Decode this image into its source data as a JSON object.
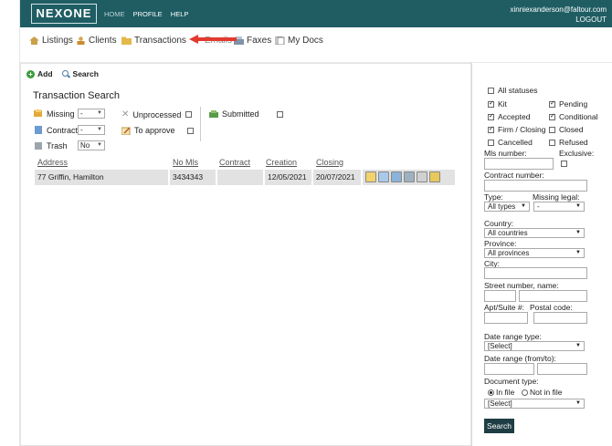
{
  "header": {
    "logo": "NEXONE",
    "nav": [
      "HOME",
      "PROFILE",
      "HELP"
    ],
    "user_email": "xinniexanderson@faltour.com",
    "logout": "LOGOUT"
  },
  "subnav": {
    "listings": "Listings",
    "clients": "Clients",
    "transactions": "Transactions",
    "emails_partial": "Emails",
    "faxes": "Faxes",
    "mydocs": "My Docs"
  },
  "toolbar": {
    "add": "Add",
    "search": "Search"
  },
  "search": {
    "title": "Transaction Search",
    "missing_label": "Missing",
    "missing_value": "-",
    "contract_label": "Contract",
    "contract_value": "-",
    "trash_label": "Trash",
    "trash_value": "No",
    "unprocessed_label": "Unprocessed",
    "to_approve_label": "To approve",
    "submitted_label": "Submitted"
  },
  "table": {
    "headers": [
      "Address",
      "No Mls",
      "Contract",
      "Creation",
      "Closing"
    ],
    "rows": [
      {
        "address": "77 Griffin, Hamilton",
        "no_mls": "3434343",
        "contract": "",
        "creation": "12/05/2021",
        "closing": "20/07/2021"
      }
    ]
  },
  "filters": {
    "all_statuses": "All statuses",
    "kit": "Kit",
    "pending": "Pending",
    "accepted": "Accepted",
    "conditional": "Conditional",
    "firm_closing": "Firm / Closing",
    "closed": "Closed",
    "cancelled": "Cancelled",
    "refused": "Refused",
    "mls_number": "Mls number:",
    "exclusive": "Exclusive:",
    "contract_number": "Contract number:",
    "type_label": "Type:",
    "type_value": "All types",
    "missing_legal_label": "Missing legal:",
    "missing_legal_value": "-",
    "country_label": "Country:",
    "country_value": "All countries",
    "province_label": "Province:",
    "province_value": "All provinces",
    "city_label": "City:",
    "street_label": "Street number, name:",
    "apt_label": "Apt/Suite #:",
    "postal_label": "Postal code:",
    "date_range_type_label": "Date range type:",
    "date_range_type_value": "[Select]",
    "date_range_label": "Date range (from/to):",
    "document_type_label": "Document type:",
    "in_file": "In file",
    "not_in_file": "Not in file",
    "document_type_value": "[Select]",
    "search_button": "Search"
  },
  "colors": {
    "header_bg": "#1f5d63",
    "search_btn": "#1f3d44",
    "arrow": "#e23a2e"
  }
}
